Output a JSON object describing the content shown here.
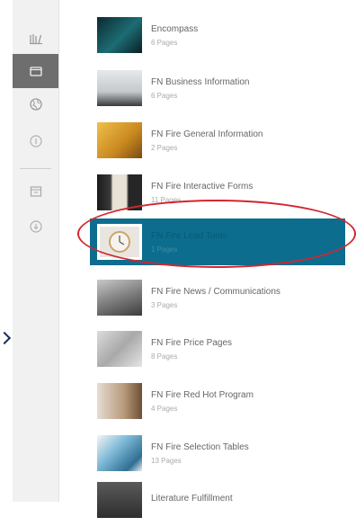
{
  "sidebar": {
    "items": [
      {
        "icon": "library-icon"
      },
      {
        "icon": "folder-icon",
        "active": true
      },
      {
        "icon": "globe-icon"
      },
      {
        "icon": "info-icon"
      },
      {
        "icon": "inbox-icon"
      },
      {
        "icon": "download-icon"
      }
    ]
  },
  "books": [
    {
      "title": "Encompass",
      "pages": "6 Pages",
      "thumb_color": "#0f3f47"
    },
    {
      "title": "FN Business Information",
      "pages": "6 Pages",
      "thumb_color": "#c9ced1"
    },
    {
      "title": "FN Fire General Information",
      "pages": "2 Pages",
      "thumb_color": "#d89a2b"
    },
    {
      "title": "FN Fire Interactive Forms",
      "pages": "11 Pages",
      "thumb_color": "#2b2b2b"
    },
    {
      "title": "FN Fire Lead Tools",
      "pages": "1 Pages",
      "thumb_color": "#d7d7d7"
    },
    {
      "title": "FN Fire News / Communications",
      "pages": "3 Pages",
      "thumb_color": "#8c8c8c"
    },
    {
      "title": "FN Fire Price Pages",
      "pages": "8 Pages",
      "thumb_color": "#b8b8b8"
    },
    {
      "title": "FN Fire Red Hot Program",
      "pages": "4 Pages",
      "thumb_color": "#c8a989"
    },
    {
      "title": "FN Fire Selection Tables",
      "pages": "13 Pages",
      "thumb_color": "#5ea5c8"
    },
    {
      "title": "Literature Fulfillment",
      "pages": "",
      "thumb_color": "#4a4a4a"
    }
  ],
  "colors": {
    "accent": "#0d6d8e",
    "highlight_ring": "#d2262e"
  }
}
